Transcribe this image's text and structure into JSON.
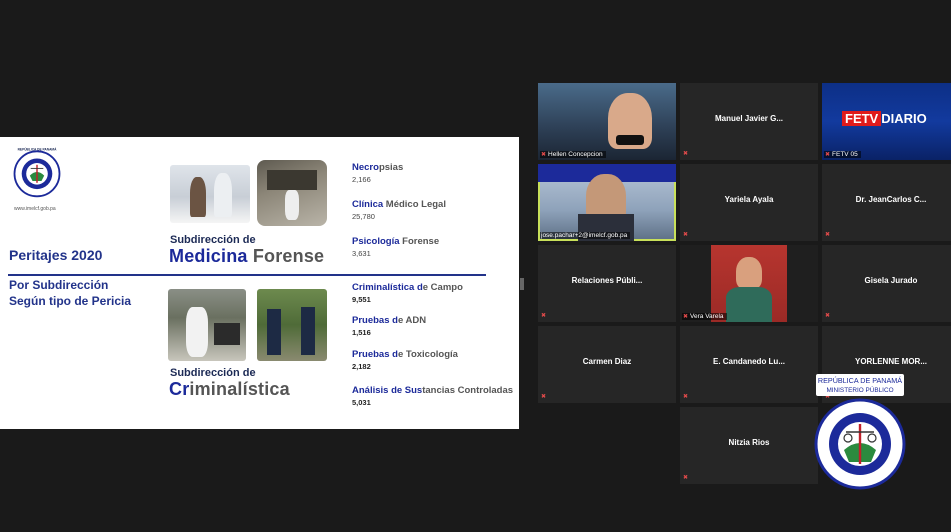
{
  "slide": {
    "logo_text": "REPÚBLICA DE PANAMÁ MINISTERIO PÚBLICO",
    "logo_ring_text": "INSTITUTO DE MEDICINA LEGAL Y CIENCIAS FORENSES",
    "url": "www.imelcf.gob.pa",
    "title": "Peritajes 2020",
    "by_sub": "Por Subdirección",
    "by_type": "Según tipo de Pericia",
    "sub1_head": "Subdirección de",
    "sub1_big_a": "Medicina",
    "sub1_big_b": " Forense",
    "sub2_head": "Subdirección de",
    "sub2_big_a": "Cr",
    "sub2_big_b": "iminalística",
    "stats": [
      {
        "hl": "Necro",
        "rest": "psias",
        "value": "2,166"
      },
      {
        "hl": "Clínica",
        "rest": " Médico Legal",
        "value": "25,780"
      },
      {
        "hl": "Psicología",
        "rest": " Forense",
        "value": "3,631"
      },
      {
        "hl": "Criminalística d",
        "rest": "e Campo",
        "value": "9,551"
      },
      {
        "hl": "Pruebas d",
        "rest": "e ADN",
        "value": "1,516"
      },
      {
        "hl": "Pruebas d",
        "rest": "e Toxicología",
        "value": "2,182"
      },
      {
        "hl": "Análisis de Sus",
        "rest": "tancias Controladas",
        "value": "5,031"
      }
    ]
  },
  "participants": {
    "hellen": "Hellen Concepcion",
    "manuel": "Manuel Javier G...",
    "fetv_logo_a": "FETV",
    "fetv_logo_b": "DIARIO",
    "fetv_tag": "FETV 05",
    "jose": "jose.pachar+2@imelcf.gob.pa",
    "yariela": "Yariela Ayala",
    "jeancarlos": "Dr. JeanCarlos C...",
    "relaciones": "Relaciones  Públi...",
    "vera": "Vera Varela",
    "gisela": "Gisela Jurado",
    "carmen": "Carmen Diaz",
    "candanedo": "E. Candanedo Lu...",
    "yorlenne": "YORLENNE  MOR...",
    "nitzia": "Nitzia Rios"
  },
  "emblem": {
    "top_text": "REPÚBLICA DE PANAMÁ",
    "sub_text": "MINISTERIO PÚBLICO",
    "ring_text": "INSTITUTO DE MEDICINA LEGAL Y CIENCIAS FORENSES"
  },
  "colors": {
    "accent": "#22338a",
    "muted_mic": "#e04a4a",
    "active_speaker": "#c8e05a"
  }
}
